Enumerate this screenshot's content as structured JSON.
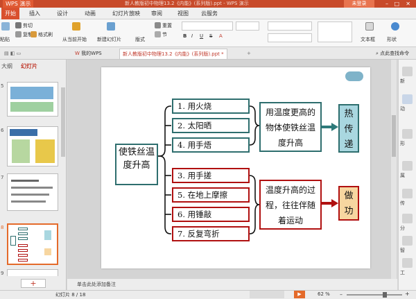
{
  "titlebar": {
    "app_name": "WPS 演示",
    "document": "新人教版初中物理13.2《内能》(系列版).ppt - WPS 演示",
    "login": "未登录"
  },
  "menu_tabs": [
    "开始",
    "插入",
    "设计",
    "动画",
    "幻灯片放映",
    "审阅",
    "视图",
    "云服务"
  ],
  "ribbon": {
    "cut": "剪切",
    "copy": "复制",
    "format_painter": "格式刷",
    "paste": "粘贴",
    "from_current": "从当前开始",
    "new_slide": "新建幻灯片",
    "layout": "版式",
    "reset": "重置",
    "section": "节",
    "textbox": "文本框",
    "shapes": "形状"
  },
  "doc_tabs": {
    "my_wps": "我的WPS",
    "document": "新人教版初中物理13.2《内能》(系列版).ppt *",
    "search": "点此查找命令"
  },
  "left_panel": {
    "outline_tab": "大纲",
    "slides_tab": "幻灯片",
    "thumb_numbers": [
      "5",
      "6",
      "7",
      "8",
      "9"
    ],
    "add_label": "+"
  },
  "right_bar": [
    "新",
    "动",
    "形",
    "属",
    "传",
    "分",
    "智",
    "工"
  ],
  "slide": {
    "left_box": "使铁丝温度升高",
    "heat_items": [
      "1. 用火烧",
      "2. 太阳晒",
      "4. 用手焐"
    ],
    "work_items": [
      "3. 用手搓",
      "5. 在地上摩擦",
      "6. 用锤敲",
      "7. 反复弯折"
    ],
    "heat_desc": "用温度更高的物体使铁丝温度升高",
    "work_desc": "温度升高的过程，往往伴随着运动",
    "heat_result": "热传递",
    "work_result": "做功",
    "colors": {
      "heat_border": "#2e6e6e",
      "work_border": "#b01010",
      "heat_fill": "#a9d7e0",
      "work_fill": "#f7d6a0"
    }
  },
  "notes_placeholder": "单击此处添加备注",
  "status": {
    "slide_counter": "幻灯片 8 / 18",
    "zoom": "62 %"
  }
}
